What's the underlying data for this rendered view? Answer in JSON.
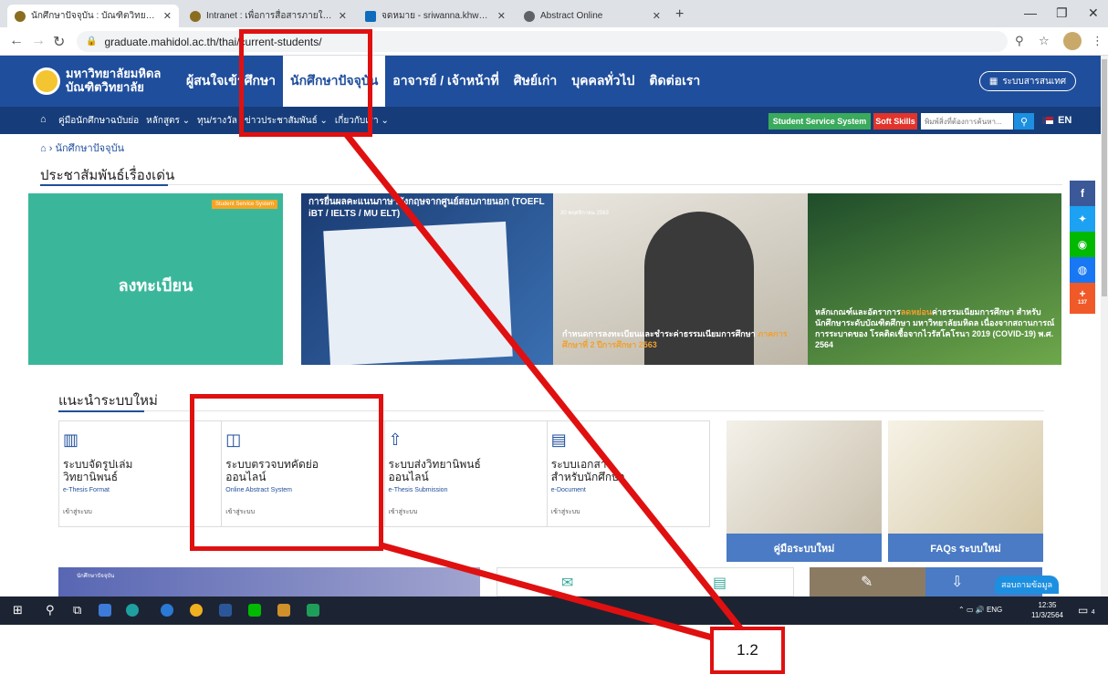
{
  "browser": {
    "tabs": [
      {
        "label": "นักศึกษาปัจจุบัน : บัณฑิตวิทยาลัย มหา",
        "favicon_color": "#8a6d1f",
        "active": true
      },
      {
        "label": "Intranet : เพื่อการสื่อสารภายในองค์กร",
        "favicon_color": "#8a6d1f",
        "active": false
      },
      {
        "label": "จดหมาย - sriwanna.khw@mahidol",
        "favicon_color": "#0f6cbd",
        "active": false
      },
      {
        "label": "Abstract Online",
        "favicon_color": "#5f6368",
        "active": false
      }
    ],
    "url": "graduate.mahidol.ac.th/thai/current-students/"
  },
  "header": {
    "logo_line1": "มหาวิทยาลัยมหิดล",
    "logo_line2": "บัณฑิตวิทยาลัย",
    "nav": [
      {
        "label": "ผู้สนใจเข้าศึกษา",
        "active": false
      },
      {
        "label": "นักศึกษาปัจจุบัน",
        "active": true
      },
      {
        "label": "อาจารย์ / เจ้าหน้าที่",
        "active": false
      },
      {
        "label": "ศิษย์เก่า",
        "active": false
      },
      {
        "label": "บุคคลทั่วไป",
        "active": false
      },
      {
        "label": "ติดต่อเรา",
        "active": false
      }
    ],
    "email_button": "ระบบสารสนเทศ"
  },
  "subnav": {
    "items": [
      "คู่มือนักศึกษาฉบับย่อ",
      "หลักสูตร",
      "ทุน/รางวัล",
      "ข่าวประชาสัมพันธ์",
      "เกี่ยวกับเรา"
    ],
    "student_service": "Student Service System",
    "soft_skills": "Soft Skills",
    "search_placeholder": "พิมพ์สิ่งที่ต้องการค้นหา...",
    "lang": "EN"
  },
  "breadcrumb": "นักศึกษาปัจจุบัน",
  "featured": {
    "heading": "ประชาสัมพันธ์เรื่องเด่น",
    "card1_tag": "Student Service System",
    "card1_title": "ลงทะเบียน",
    "card2_title": "การยื่นผลคะแนนภาษาอังกฤษจากศูนย์สอบภายนอก (TOEFL iBT / IELTS / MU ELT)",
    "card3_date": "30 พฤศจิกายน 2563",
    "card3_caption_a": "กำหนดการลงทะเบียนและชำระค่าธรรมเนียมการศึกษา",
    "card3_caption_b": "ภาคการศึกษาที่ 2 ปีการศึกษา 2563",
    "card4_caption_a": "หลักเกณฑ์และอัตราการ",
    "card4_caption_hl": "ลดหย่อน",
    "card4_caption_b": "ค่าธรรมเนียมการศึกษา สำหรับนักศึกษาระดับบัณฑิตศึกษา มหาวิทยาลัยมหิดล เนื่องจากสถานการณ์การระบาดของ โรคติดเชื้อจากไวรัสโคโรนา 2019 (COVID-19) พ.ศ. 2564"
  },
  "social": {
    "share_count": "137"
  },
  "new_systems": {
    "heading": "แนะนำระบบใหม่",
    "items": [
      {
        "icon": "book-icon",
        "name1": "ระบบจัดรูปเล่ม",
        "name2": "วิทยานิพนธ์",
        "en": "e-Thesis Format",
        "go": "เข้าสู่ระบบ"
      },
      {
        "icon": "abstract-icon",
        "name1": "ระบบตรวจบทคัดย่อ",
        "name2": "ออนไลน์",
        "en": "Online Abstract System",
        "go": "เข้าสู่ระบบ"
      },
      {
        "icon": "upload-icon",
        "name1": "ระบบส่งวิทยานิพนธ์",
        "name2": "ออนไลน์",
        "en": "e-Thesis Submission",
        "go": "เข้าสู่ระบบ"
      },
      {
        "icon": "document-icon",
        "name1": "ระบบเอกสาร",
        "name2": "สำหรับนักศึกษา",
        "en": "e-Document",
        "go": "เข้าสู่ระบบ"
      }
    ],
    "manual_label": "คู่มือระบบใหม่",
    "faq_label": "FAQs ระบบใหม่"
  },
  "bottom": {
    "blue_caption": "นักศึกษาปัจจุบัน",
    "contact": "สอบถามข้อมูล"
  },
  "taskbar": {
    "lang": "ENG",
    "time": "12:35",
    "date": "11/3/2564",
    "notifications": "4"
  },
  "annotation": {
    "label": "1.2",
    "color": "#e01010"
  }
}
